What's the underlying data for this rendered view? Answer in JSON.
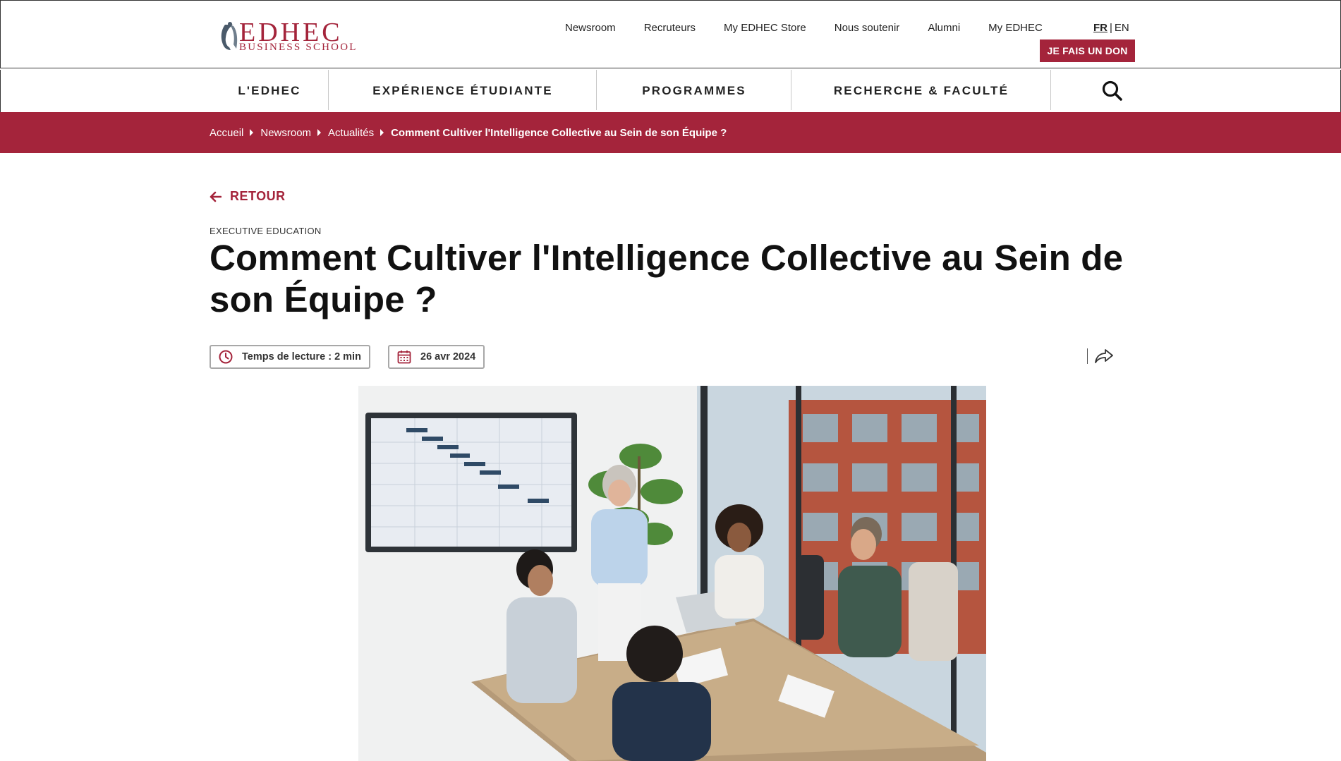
{
  "logo": {
    "word": "EDHEC",
    "subtitle": "BUSINESS SCHOOL"
  },
  "top_links": [
    "Newsroom",
    "Recruteurs",
    "My EDHEC Store",
    "Nous soutenir",
    "Alumni",
    "My EDHEC"
  ],
  "language": {
    "fr": "FR",
    "separator": "|",
    "en": "EN"
  },
  "donate_label": "JE FAIS UN DON",
  "main_nav": [
    "L'EDHEC",
    "EXPÉRIENCE ÉTUDIANTE",
    "PROGRAMMES",
    "RECHERCHE & FACULTÉ"
  ],
  "breadcrumb": {
    "items": [
      "Accueil",
      "Newsroom",
      "Actualités"
    ],
    "current": "Comment Cultiver l'Intelligence Collective au Sein de son Équipe ?"
  },
  "article": {
    "back_label": "RETOUR",
    "category": "EXECUTIVE EDUCATION",
    "title": "Comment Cultiver l'Intelligence Collective au Sein de son Équipe ?",
    "reading_time": "Temps de lecture : 2 min",
    "date": "26 avr 2024"
  },
  "icons": {
    "search": "search-icon",
    "back": "arrow-left-icon",
    "clock": "clock-icon",
    "calendar": "calendar-icon",
    "share": "share-icon"
  },
  "colors": {
    "brand": "#a4243b",
    "text": "#111111",
    "border": "#a8a8a8"
  }
}
